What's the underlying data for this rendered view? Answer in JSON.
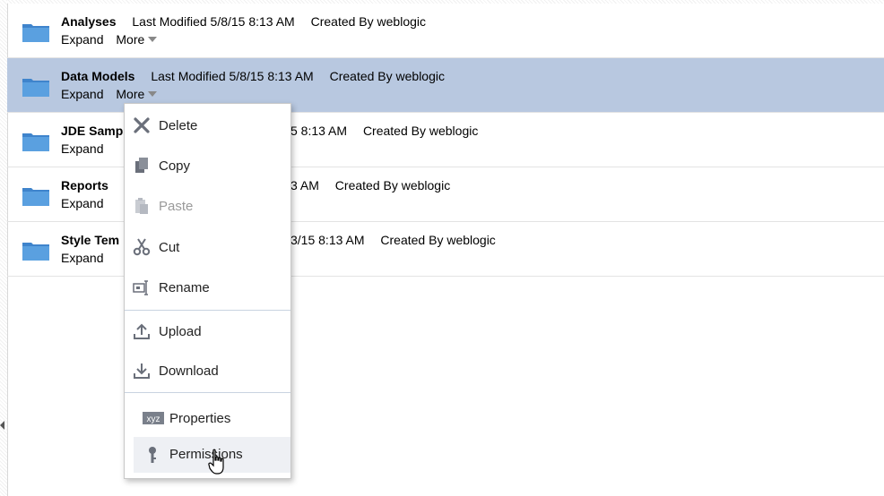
{
  "rows": [
    {
      "name": "Analyses",
      "last_modified": "Last Modified 5/8/15 8:13 AM",
      "created_by": "Created By weblogic",
      "expand": "Expand",
      "more": "More"
    },
    {
      "name": "Data Models",
      "last_modified": "Last Modified 5/8/15 8:13 AM",
      "created_by": "Created By weblogic",
      "expand": "Expand",
      "more": "More"
    },
    {
      "name": "JDE Samp",
      "last_modified": "5 8:13 AM",
      "created_by": "Created By weblogic",
      "expand": "Expand"
    },
    {
      "name": "Reports",
      "last_modified": "3 AM",
      "created_by": "Created By weblogic",
      "expand": "Expand"
    },
    {
      "name": "Style Tem",
      "last_modified": "3/15 8:13 AM",
      "created_by": "Created By weblogic",
      "expand": "Expand"
    }
  ],
  "menu": {
    "delete": "Delete",
    "copy": "Copy",
    "paste": "Paste",
    "cut": "Cut",
    "rename": "Rename",
    "upload": "Upload",
    "download": "Download",
    "properties": "Properties",
    "properties_icon_text": "xyz",
    "permissions": "Permissions"
  },
  "colors": {
    "selected_row": "#b8c8e0",
    "folder": "#4a8fd4",
    "menu_border": "#c8c8c8"
  }
}
